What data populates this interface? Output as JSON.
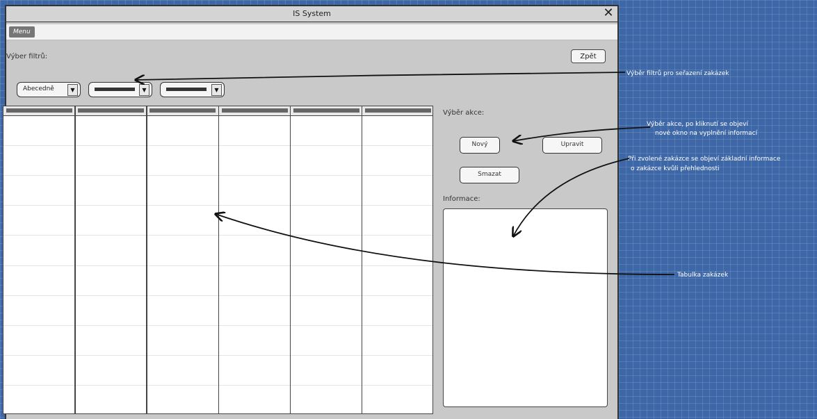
{
  "window": {
    "title": "IS System",
    "close_glyph": "✕"
  },
  "menu": {
    "label": "Menu"
  },
  "filters": {
    "label": "Výber filtrů:",
    "back_label": "Zpět",
    "dropdowns": [
      {
        "value": "Abecedně"
      },
      {
        "value": ""
      },
      {
        "value": ""
      }
    ]
  },
  "actions": {
    "label": "Výběr akce:",
    "new_label": "Nový",
    "edit_label": "Upravit",
    "delete_label": "Smazat"
  },
  "info": {
    "label": "Informace:"
  },
  "table": {
    "columns": [
      "",
      "",
      "",
      "",
      "",
      ""
    ],
    "rows": 10
  },
  "annotations": {
    "filters_note": "Výběr filtrů pro seřazení zakázek",
    "actions_note_line1": "Výběr akce, po kliknutí se objeví",
    "actions_note_line2": "nové okno na vyplnění informací",
    "info_note_line1": "Při zvolené zakázce se objeví základní informace",
    "info_note_line2": "o zakázce kvůli přehlednosti",
    "table_note": "Tabulka zakázek"
  },
  "colors": {
    "background": "#3d67a7",
    "window": "#c9c9c9",
    "annotation_text": "#ffffff"
  }
}
